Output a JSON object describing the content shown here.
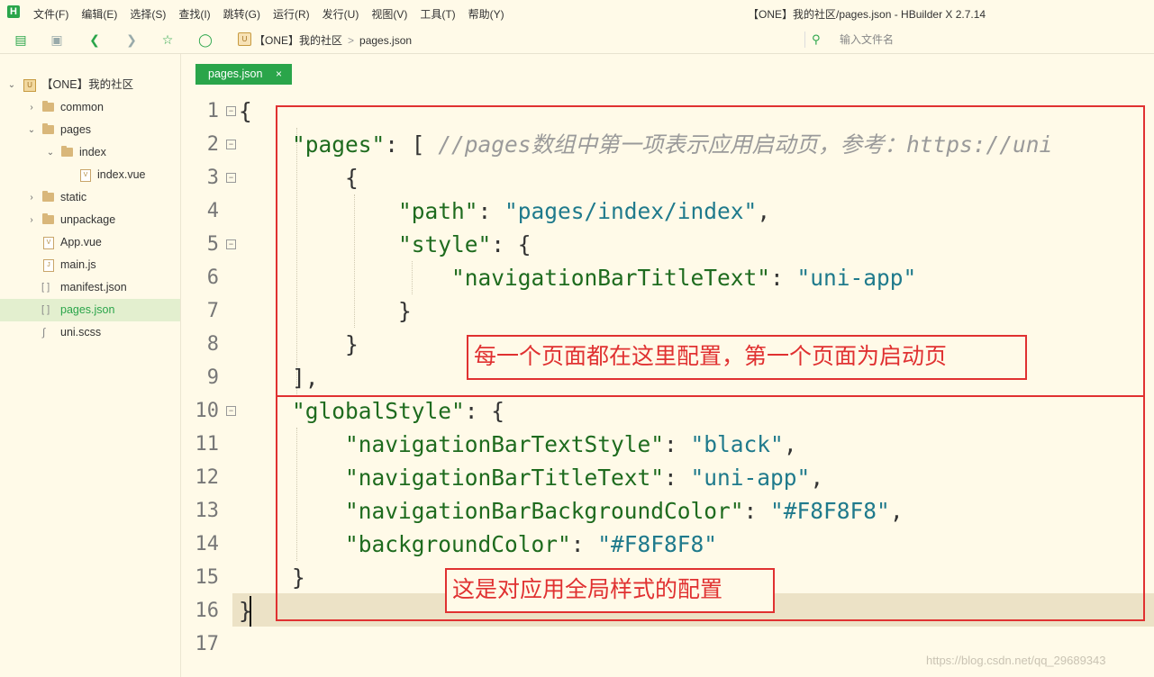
{
  "app": {
    "logo_letter": "H",
    "window_title": "【ONE】我的社区/pages.json - HBuilder X 2.7.14"
  },
  "menu": [
    "文件(F)",
    "编辑(E)",
    "选择(S)",
    "查找(I)",
    "跳转(G)",
    "运行(R)",
    "发行(U)",
    "视图(V)",
    "工具(T)",
    "帮助(Y)"
  ],
  "breadcrumb": {
    "project": "【ONE】我的社区",
    "file": "pages.json",
    "separator": ">"
  },
  "search": {
    "placeholder": "输入文件名"
  },
  "sidebar": {
    "project": "【ONE】我的社区",
    "items": [
      {
        "label": "common",
        "type": "folder"
      },
      {
        "label": "pages",
        "type": "folder-open"
      },
      {
        "label": "index",
        "type": "folder-open"
      },
      {
        "label": "index.vue",
        "type": "vue"
      },
      {
        "label": "static",
        "type": "folder"
      },
      {
        "label": "unpackage",
        "type": "folder"
      },
      {
        "label": "App.vue",
        "type": "vue"
      },
      {
        "label": "main.js",
        "type": "js"
      },
      {
        "label": "manifest.json",
        "type": "json"
      },
      {
        "label": "pages.json",
        "type": "json",
        "selected": true
      },
      {
        "label": "uni.scss",
        "type": "scss"
      }
    ]
  },
  "tab": {
    "label": "pages.json",
    "close": "×"
  },
  "editor": {
    "line_numbers": [
      "1",
      "2",
      "3",
      "4",
      "5",
      "6",
      "7",
      "8",
      "9",
      "10",
      "11",
      "12",
      "13",
      "14",
      "15",
      "16",
      "17"
    ],
    "lines": [
      "{",
      "    \"pages\": [ //pages数组中第一项表示应用启动页，参考：https://uni",
      "        {",
      "            \"path\": \"pages/index/index\",",
      "            \"style\": {",
      "                \"navigationBarTitleText\": \"uni-app\"",
      "            }",
      "        }",
      "    ],",
      "    \"globalStyle\": {",
      "        \"navigationBarTextStyle\": \"black\",",
      "        \"navigationBarTitleText\": \"uni-app\",",
      "        \"navigationBarBackgroundColor\": \"#F8F8F8\",",
      "        \"backgroundColor\": \"#F8F8F8\"",
      "    }",
      "}",
      ""
    ]
  },
  "annotations": {
    "pages_note": "每一个页面都在这里配置，第一个页面为启动页",
    "global_note": "这是对应用全局样式的配置"
  },
  "watermark": "https://blog.csdn.net/qq_29689343",
  "colors": {
    "accent": "#2aa54a",
    "annotation": "#e03131",
    "background": "#fffae8"
  }
}
